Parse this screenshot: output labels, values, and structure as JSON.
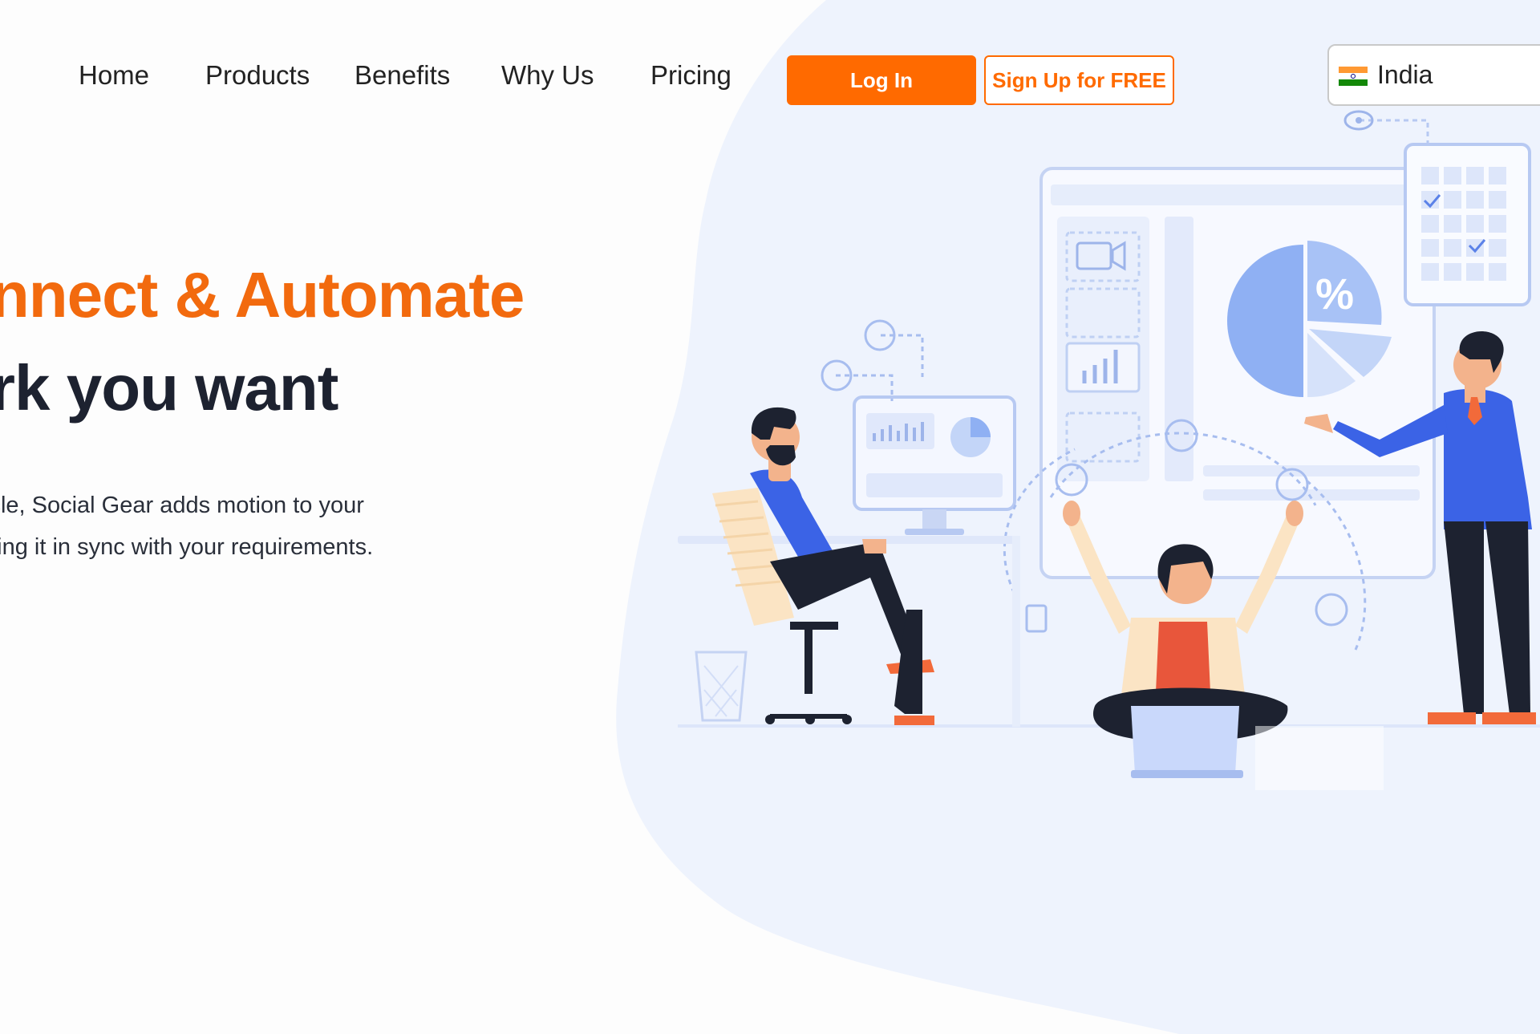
{
  "nav": {
    "items": [
      {
        "label": "Home"
      },
      {
        "label": "Products"
      },
      {
        "label": "Benefits"
      },
      {
        "label": "Why Us"
      },
      {
        "label": "Pricing"
      }
    ],
    "login_label": "Log In",
    "signup_label": "Sign Up for FREE",
    "country": {
      "name": "India",
      "flag_icon": "india-flag-icon"
    }
  },
  "hero": {
    "headline_line1": "onnect & Automate",
    "headline_line2": "ork you want",
    "subtext_line1": "icle, Social Gear adds motion to your",
    "subtext_line2": "oing it in sync with your requirements."
  },
  "colors": {
    "accent": "#ff6a00",
    "headline_orange": "#f26a0e",
    "headline_dark": "#1d2230",
    "blob": "#eef3fd",
    "illustration_blue": "#3b63e6"
  }
}
